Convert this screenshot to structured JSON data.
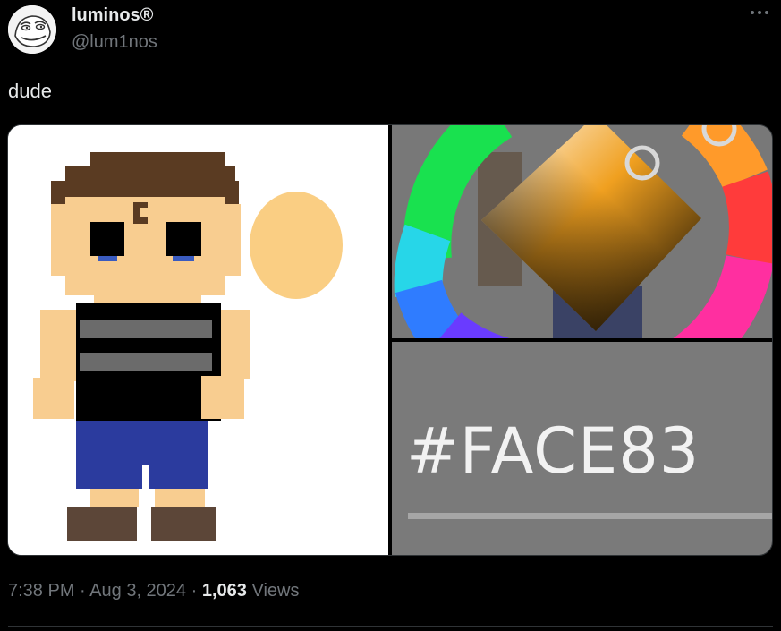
{
  "author": {
    "display_name": "luminos®",
    "handle": "@lum1nos",
    "avatar_icon": "meme-face-avatar"
  },
  "more_icon": "more-dots-icon",
  "tweet": {
    "text": "dude"
  },
  "media": {
    "hex_code": "#FACE83",
    "picked_color": "#FACE83",
    "images": [
      {
        "icon": "pixel-character-image"
      },
      {
        "icon": "color-wheel-picker-image"
      },
      {
        "icon": "hex-code-image"
      }
    ]
  },
  "meta": {
    "time": "7:38 PM",
    "separator": "·",
    "date": "Aug 3, 2024",
    "views_count": "1,063",
    "views_label": "Views"
  },
  "colors": {
    "background": "#000000",
    "primary_text": "#e7e9ea",
    "secondary_text": "#71767b",
    "divider": "#2f3336"
  }
}
